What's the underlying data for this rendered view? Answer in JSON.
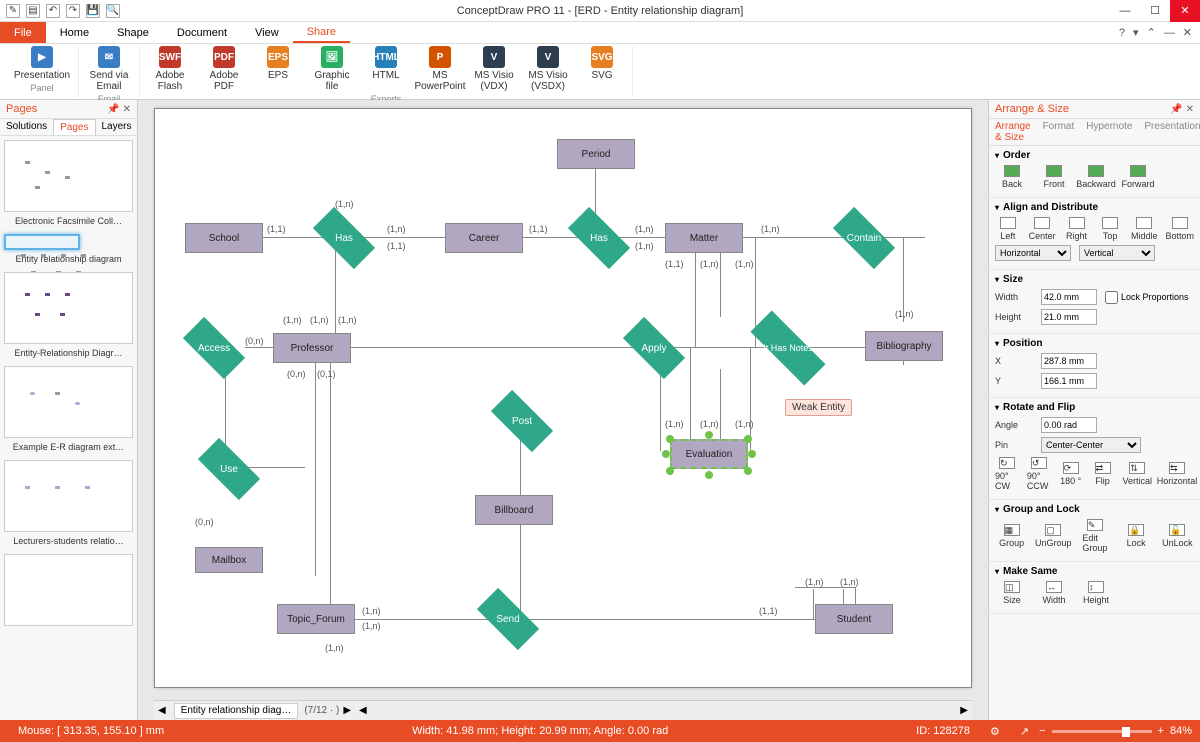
{
  "app_title": "ConceptDraw PRO 11 - [ERD - Entity relationship diagram]",
  "tabs": {
    "file": "File",
    "home": "Home",
    "shape": "Shape",
    "document": "Document",
    "view": "View",
    "share": "Share"
  },
  "ribbon": {
    "panel": {
      "label": "Panel",
      "presentation": "Presentation"
    },
    "email": {
      "send": "Send via\nEmail",
      "label": "Email"
    },
    "exports": {
      "flash": "Adobe\nFlash",
      "pdf": "Adobe\nPDF",
      "eps": "EPS",
      "gfile": "Graphic\nfile",
      "html": "HTML",
      "ppt": "MS\nPowerPoint",
      "vdx": "MS Visio\n(VDX)",
      "vsdx": "MS Visio\n(VSDX)",
      "svg": "SVG",
      "label": "Exports"
    }
  },
  "pages_panel": {
    "title": "Pages",
    "tabs": {
      "solutions": "Solutions",
      "pages": "Pages",
      "layers": "Layers"
    },
    "thumbs": [
      "Electronic Facsimile Coll…",
      "Entity relationship diagram",
      "Entity-Relationship Diagr…",
      "Example E-R diagram ext…",
      "Lecturers-students relatio…"
    ]
  },
  "diagram": {
    "entities": {
      "period": "Period",
      "school": "School",
      "career": "Career",
      "matter": "Matter",
      "bibliography": "Bibliography",
      "professor": "Professor",
      "billboard": "Billboard",
      "mailbox": "Mailbox",
      "topic_forum": "Topic_Forum",
      "student": "Student",
      "evaluation": "Evaluation"
    },
    "relationships": {
      "has1": "Has",
      "has2": "Has",
      "contain": "Contain",
      "access": "Access",
      "apply": "Apply",
      "ithasnotes": "It Has Notes",
      "use": "Use",
      "post": "Post",
      "send": "Send"
    },
    "cards": {
      "c1": "(1,n)",
      "c2": "(1,1)",
      "c3": "(1,n)",
      "c4": "(1,1)",
      "c5": "(1,1)",
      "c6": "(1,n)",
      "c7": "(1,n)",
      "c8": "(1,n)",
      "c9": "(1,1)",
      "c10": "(1,n)",
      "c11": "(1,n)",
      "c12": "(0,n)",
      "c13": "(1,n)",
      "c14": "(1,n)",
      "c15": "(1,n)",
      "c16": "(0,n)",
      "c17": "(0,1)",
      "c18": "(1,n)",
      "c19": "(1,n)",
      "c20": "(1,n)",
      "c21": "(1,n)",
      "c22": "(1,n)",
      "c23": "(1,n)",
      "c24": "(1,1)",
      "c25": "(0,n)",
      "c26": "(1,n)"
    },
    "tooltip": "Weak Entity"
  },
  "bottom": {
    "tab": "Entity relationship diag…",
    "pager": "(7/12"
  },
  "right_panel": {
    "title": "Arrange & Size",
    "tabs": {
      "arrange": "Arrange & Size",
      "format": "Format",
      "hypernote": "Hypernote",
      "presentation": "Presentation"
    },
    "order": {
      "title": "Order",
      "back": "Back",
      "front": "Front",
      "backward": "Backward",
      "forward": "Forward"
    },
    "align": {
      "title": "Align and Distribute",
      "left": "Left",
      "center": "Center",
      "right": "Right",
      "top": "Top",
      "middle": "Middle",
      "bottom": "Bottom",
      "horiz": "Horizontal",
      "vert": "Vertical"
    },
    "size": {
      "title": "Size",
      "width_lbl": "Width",
      "width": "42.0 mm",
      "height_lbl": "Height",
      "height": "21.0 mm",
      "lock": "Lock Proportions"
    },
    "position": {
      "title": "Position",
      "x_lbl": "X",
      "x": "287.8 mm",
      "y_lbl": "Y",
      "y": "166.1 mm"
    },
    "rotate": {
      "title": "Rotate and Flip",
      "angle_lbl": "Angle",
      "angle": "0.00 rad",
      "pin_lbl": "Pin",
      "pin": "Center-Center",
      "cw": "90° CW",
      "ccw": "90° CCW",
      "180": "180 °",
      "flip": "Flip",
      "vert": "Vertical",
      "horiz": "Horizontal"
    },
    "grouplock": {
      "title": "Group and Lock",
      "group": "Group",
      "ungroup": "UnGroup",
      "edit": "Edit\nGroup",
      "lock": "Lock",
      "unlock": "UnLock"
    },
    "makesame": {
      "title": "Make Same",
      "size": "Size",
      "width": "Width",
      "height": "Height"
    }
  },
  "status": {
    "mouse": "Mouse: [ 313.35, 155.10 ] mm",
    "dims": "Width: 41.98 mm; Height: 20.99 mm; Angle: 0.00 rad",
    "id": "ID: 128278",
    "zoom": "84%"
  }
}
